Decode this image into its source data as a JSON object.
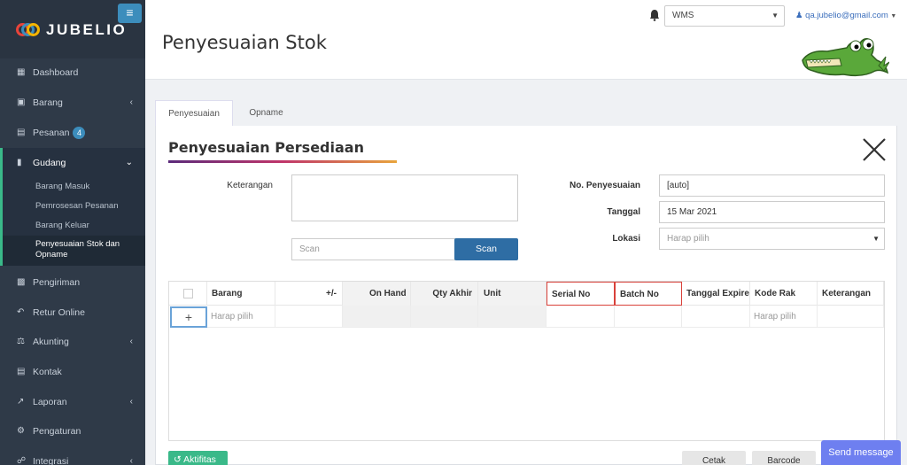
{
  "app": {
    "logo_text": "JUBELIO",
    "brand_color": "#3c8dbc",
    "accent_green": "#3ab989",
    "sidebar_bg": "#2f3a48"
  },
  "sidebar": {
    "menu_icon": "hamburger-icon",
    "items": [
      {
        "label": "Dashboard",
        "icon": "dashboard-icon"
      },
      {
        "label": "Barang",
        "icon": "cubes-icon"
      },
      {
        "label": "Pesanan",
        "icon": "basket-icon",
        "badge": "4"
      },
      {
        "label": "Gudang",
        "icon": "warehouse-icon"
      },
      {
        "label": "Pengiriman",
        "icon": "truck-icon"
      },
      {
        "label": "Retur Online",
        "icon": "reply-icon"
      },
      {
        "label": "Akunting",
        "icon": "balance-scale-icon"
      },
      {
        "label": "Kontak",
        "icon": "address-card-icon"
      },
      {
        "label": "Laporan",
        "icon": "line-chart-icon"
      },
      {
        "label": "Pengaturan",
        "icon": "gears-icon"
      },
      {
        "label": "Integrasi",
        "icon": "plug-icon"
      }
    ],
    "gudang_sub": [
      {
        "label": "Barang Masuk"
      },
      {
        "label": "Pemrosesan Pesanan"
      },
      {
        "label": "Barang Keluar"
      },
      {
        "label": "Penyesuaian Stok dan",
        "label2": "Opname"
      }
    ]
  },
  "header": {
    "page_title": "Penyesuaian Stok",
    "warehouse_select": "WMS",
    "user_email": "qa.jubelio@gmail.com"
  },
  "tabs": [
    {
      "label": "Penyesuaian"
    },
    {
      "label": "Opname"
    }
  ],
  "form": {
    "title": "Penyesuaian Persediaan",
    "keterangan_label": "Keterangan",
    "scan_placeholder": "Scan",
    "scan_button": "Scan",
    "no_label": "No. Penyesuaian",
    "no_value": "[auto]",
    "tanggal_label": "Tanggal",
    "tanggal_value": "15 Mar 2021",
    "lokasi_label": "Lokasi",
    "lokasi_placeholder": "Harap pilih"
  },
  "grid": {
    "columns": [
      "Barang",
      "+/-",
      "On Hand",
      "Qty Akhir",
      "Unit",
      "Serial No",
      "Batch No",
      "Tanggal Expired",
      "Kode Rak",
      "Keterangan"
    ],
    "row": {
      "barang": "Harap pilih",
      "kode_rak": "Harap pilih"
    }
  },
  "footer": {
    "aktifitas": "Aktifitas",
    "cetak": "Cetak",
    "barcode": "Barcode",
    "send_message": "Send message"
  }
}
